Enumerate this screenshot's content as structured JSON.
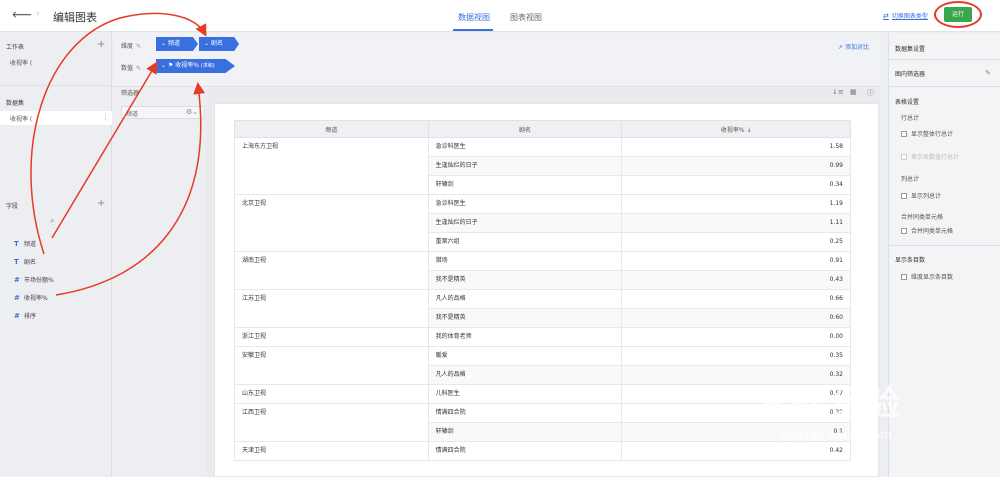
{
  "header": {
    "back_icon": "arrow-left-icon",
    "title": "编辑图表",
    "tabs": [
      {
        "label": "数据视图",
        "active": true
      },
      {
        "label": "图表视图",
        "active": false
      }
    ],
    "switch_chart_type": "切换图表类型",
    "run_label": "运行"
  },
  "left_panel": {
    "worksheet_title": "工作表",
    "worksheet_item": "收视率 (",
    "dataset_title": "数据集",
    "dataset_item": "收视率 (",
    "fields_title": "字段",
    "fields": [
      {
        "type": "T",
        "label": "频道"
      },
      {
        "type": "T",
        "label": "剧名"
      },
      {
        "type": "#",
        "label": "市场份额%"
      },
      {
        "type": "#",
        "label": "收视率%"
      },
      {
        "type": "#",
        "label": "排序"
      }
    ]
  },
  "shelf": {
    "dimension_label": "维度",
    "dimension_pills": [
      "频道",
      "剧名"
    ],
    "data_label": "数值",
    "data_pill": "收视率%",
    "data_pill_agg": "(求和)",
    "add_compare": "添加对比",
    "filter_label": "筛选器",
    "filter_item": "频道"
  },
  "table": {
    "headers": [
      "频道",
      "剧名",
      "收视率% ↓"
    ],
    "groups": [
      {
        "channel": "上海东方卫视",
        "rows": [
          [
            "急诊科医生",
            "1.58"
          ],
          [
            "生逢灿烂的日子",
            "0.99"
          ],
          [
            "轩辕剑",
            "0.34"
          ]
        ]
      },
      {
        "channel": "北京卫视",
        "rows": [
          [
            "急诊科医生",
            "1.19"
          ],
          [
            "生逢灿烂的日子",
            "1.11"
          ],
          [
            "重案六组",
            "0.25"
          ]
        ]
      },
      {
        "channel": "湖南卫视",
        "rows": [
          [
            "猎场",
            "0.91"
          ],
          [
            "我不是精英",
            "0.43"
          ]
        ]
      },
      {
        "channel": "江苏卫视",
        "rows": [
          [
            "凡人的品格",
            "0.66"
          ],
          [
            "我不是精英",
            "0.60"
          ]
        ]
      },
      {
        "channel": "浙江卫视",
        "rows": [
          [
            "我的体育老师",
            "0.00"
          ]
        ]
      },
      {
        "channel": "安徽卫视",
        "rows": [
          [
            "暖爱",
            "0.35"
          ],
          [
            "凡人的品格",
            "0.32"
          ]
        ]
      },
      {
        "channel": "山东卫视",
        "rows": [
          [
            "儿科医生",
            "0.57"
          ]
        ]
      },
      {
        "channel": "江西卫视",
        "rows": [
          [
            "情满四合院",
            "0.32"
          ],
          [
            "轩辕剑",
            "0.1"
          ]
        ]
      },
      {
        "channel": "天津卫视",
        "rows": [
          [
            "情满四合院",
            "0.42"
          ]
        ]
      }
    ]
  },
  "right_panel": {
    "dataset_settings": "数据集设置",
    "chart_filter": "图内筛选器",
    "table_settings": "表格设置",
    "row_total": "行总计",
    "show_row_total": "显示整体行总计",
    "show_dim_row_total": "显示各数值行总计",
    "col_total": "列总计",
    "show_col_total": "显示列总计",
    "merge_cells": "合并同类单元格",
    "merge_cells_check": "合并同类单元格",
    "show_entries": "显示条目数",
    "show_entries_check": "维度显示条目数"
  },
  "watermark": {
    "main": "Bai 经验",
    "sub": "jingyan.baidu.com"
  },
  "colors": {
    "accent": "#3a6fe0",
    "run": "#3aa54a",
    "annotation": "#e53b27"
  }
}
